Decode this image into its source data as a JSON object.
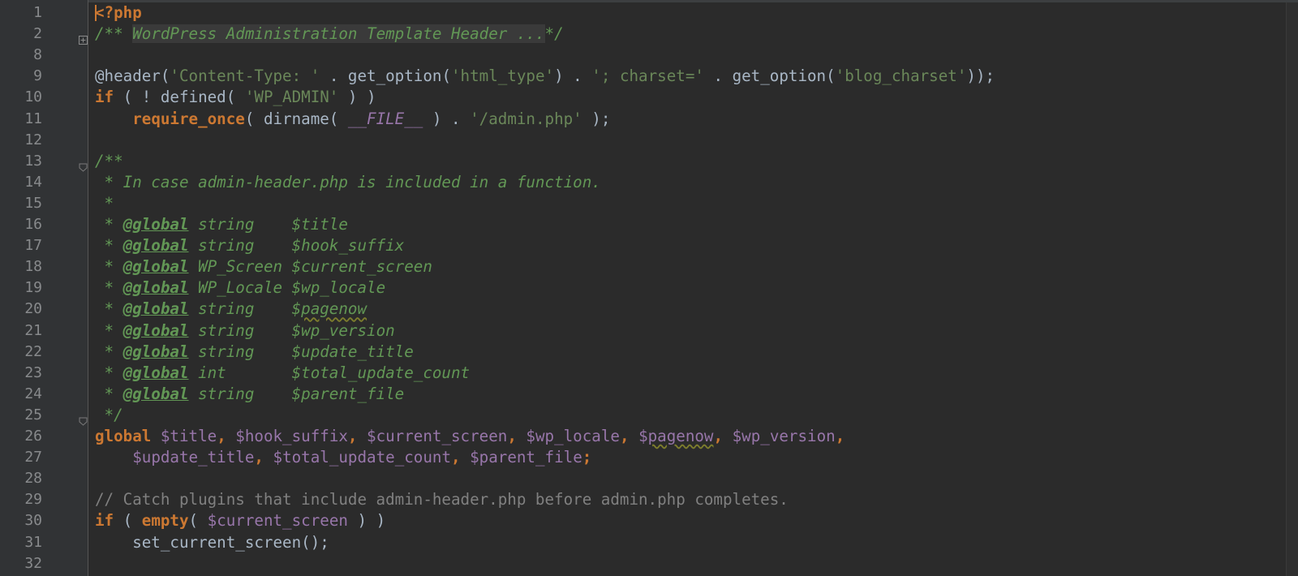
{
  "editor": {
    "language": "php",
    "lines": [
      {
        "n": "1",
        "tokens": [
          [
            "kw",
            "<?php"
          ]
        ]
      },
      {
        "n": "2",
        "fold": "expand",
        "folded": true,
        "tokens": [
          [
            "doc",
            "/** "
          ],
          [
            "foldtext",
            "WordPress Administration Template Header ..."
          ],
          [
            "doc",
            "*/"
          ]
        ]
      },
      {
        "n": "8",
        "tokens": []
      },
      {
        "n": "9",
        "tokens": [
          [
            "fn",
            "@header("
          ],
          [
            "str",
            "'Content-Type: '"
          ],
          [
            "fn",
            " . get_option("
          ],
          [
            "str",
            "'html_type'"
          ],
          [
            "fn",
            ") . "
          ],
          [
            "str",
            "'; charset='"
          ],
          [
            "fn",
            " . get_option("
          ],
          [
            "str",
            "'blog_charset'"
          ],
          [
            "fn",
            "));"
          ]
        ]
      },
      {
        "n": "10",
        "tokens": [
          [
            "kw",
            "if"
          ],
          [
            "fn",
            " ( ! defined( "
          ],
          [
            "str",
            "'WP_ADMIN'"
          ],
          [
            "fn",
            " ) )"
          ]
        ]
      },
      {
        "n": "11",
        "tokens": [
          [
            "fn",
            "    "
          ],
          [
            "kw",
            "require_once"
          ],
          [
            "fn",
            "( dirname( "
          ],
          [
            "const",
            "__FILE__"
          ],
          [
            "fn",
            " ) . "
          ],
          [
            "str",
            "'/admin.php'"
          ],
          [
            "fn",
            " );"
          ]
        ]
      },
      {
        "n": "12",
        "tokens": []
      },
      {
        "n": "13",
        "fold": "collapse",
        "tokens": [
          [
            "doc",
            "/**"
          ]
        ]
      },
      {
        "n": "14",
        "tokens": [
          [
            "doc",
            " * In case admin-header.php is included in a function."
          ]
        ]
      },
      {
        "n": "15",
        "tokens": [
          [
            "doc",
            " *"
          ]
        ]
      },
      {
        "n": "16",
        "tokens": [
          [
            "doc",
            " * "
          ],
          [
            "doctag",
            "@global"
          ],
          [
            "doc",
            " string    $title"
          ]
        ]
      },
      {
        "n": "17",
        "tokens": [
          [
            "doc",
            " * "
          ],
          [
            "doctag",
            "@global"
          ],
          [
            "doc",
            " string    $hook_suffix"
          ]
        ]
      },
      {
        "n": "18",
        "tokens": [
          [
            "doc",
            " * "
          ],
          [
            "doctag",
            "@global"
          ],
          [
            "doc",
            " WP_Screen $current_screen"
          ]
        ]
      },
      {
        "n": "19",
        "tokens": [
          [
            "doc",
            " * "
          ],
          [
            "doctag",
            "@global"
          ],
          [
            "doc",
            " WP_Locale $wp_locale"
          ]
        ]
      },
      {
        "n": "20",
        "tokens": [
          [
            "doc",
            " * "
          ],
          [
            "doctag",
            "@global"
          ],
          [
            "doc",
            " string    $"
          ],
          [
            "docwavy",
            "pagenow"
          ]
        ]
      },
      {
        "n": "21",
        "tokens": [
          [
            "doc",
            " * "
          ],
          [
            "doctag",
            "@global"
          ],
          [
            "doc",
            " string    $wp_version"
          ]
        ]
      },
      {
        "n": "22",
        "tokens": [
          [
            "doc",
            " * "
          ],
          [
            "doctag",
            "@global"
          ],
          [
            "doc",
            " string    $update_title"
          ]
        ]
      },
      {
        "n": "23",
        "tokens": [
          [
            "doc",
            " * "
          ],
          [
            "doctag",
            "@global"
          ],
          [
            "doc",
            " int       $total_update_count"
          ]
        ]
      },
      {
        "n": "24",
        "tokens": [
          [
            "doc",
            " * "
          ],
          [
            "doctag",
            "@global"
          ],
          [
            "doc",
            " string    $parent_file"
          ]
        ]
      },
      {
        "n": "25",
        "fold": "collapse",
        "tokens": [
          [
            "doc",
            " */"
          ]
        ]
      },
      {
        "n": "26",
        "tokens": [
          [
            "kw",
            "global"
          ],
          [
            "fn",
            " "
          ],
          [
            "var",
            "$title"
          ],
          [
            "kw",
            ", "
          ],
          [
            "var",
            "$hook_suffix"
          ],
          [
            "kw",
            ", "
          ],
          [
            "var",
            "$current_screen"
          ],
          [
            "kw",
            ", "
          ],
          [
            "var",
            "$wp_locale"
          ],
          [
            "kw",
            ", "
          ],
          [
            "var",
            "$"
          ],
          [
            "varwavy",
            "pagenow"
          ],
          [
            "kw",
            ", "
          ],
          [
            "var",
            "$wp_version"
          ],
          [
            "kw",
            ","
          ]
        ]
      },
      {
        "n": "27",
        "tokens": [
          [
            "fn",
            "    "
          ],
          [
            "var",
            "$update_title"
          ],
          [
            "kw",
            ", "
          ],
          [
            "var",
            "$total_update_count"
          ],
          [
            "kw",
            ", "
          ],
          [
            "var",
            "$parent_file"
          ],
          [
            "kw",
            ";"
          ]
        ]
      },
      {
        "n": "28",
        "tokens": []
      },
      {
        "n": "29",
        "tokens": [
          [
            "cmt",
            "// Catch plugins that include admin-header.php before admin.php completes."
          ]
        ]
      },
      {
        "n": "30",
        "tokens": [
          [
            "kw",
            "if"
          ],
          [
            "fn",
            " ( "
          ],
          [
            "kw",
            "empty"
          ],
          [
            "fn",
            "( "
          ],
          [
            "var",
            "$current_screen"
          ],
          [
            "fn",
            " ) )"
          ]
        ]
      },
      {
        "n": "31",
        "tokens": [
          [
            "fn",
            "    set_current_screen();"
          ]
        ]
      },
      {
        "n": "32",
        "tokens": []
      }
    ]
  },
  "colors": {
    "background": "#2b2b2b",
    "gutter": "#313335",
    "keyword": "#cc7832",
    "string": "#6a8759",
    "variable": "#9876aa",
    "doc": "#629755",
    "comment": "#808080",
    "text": "#a9b7c6"
  }
}
